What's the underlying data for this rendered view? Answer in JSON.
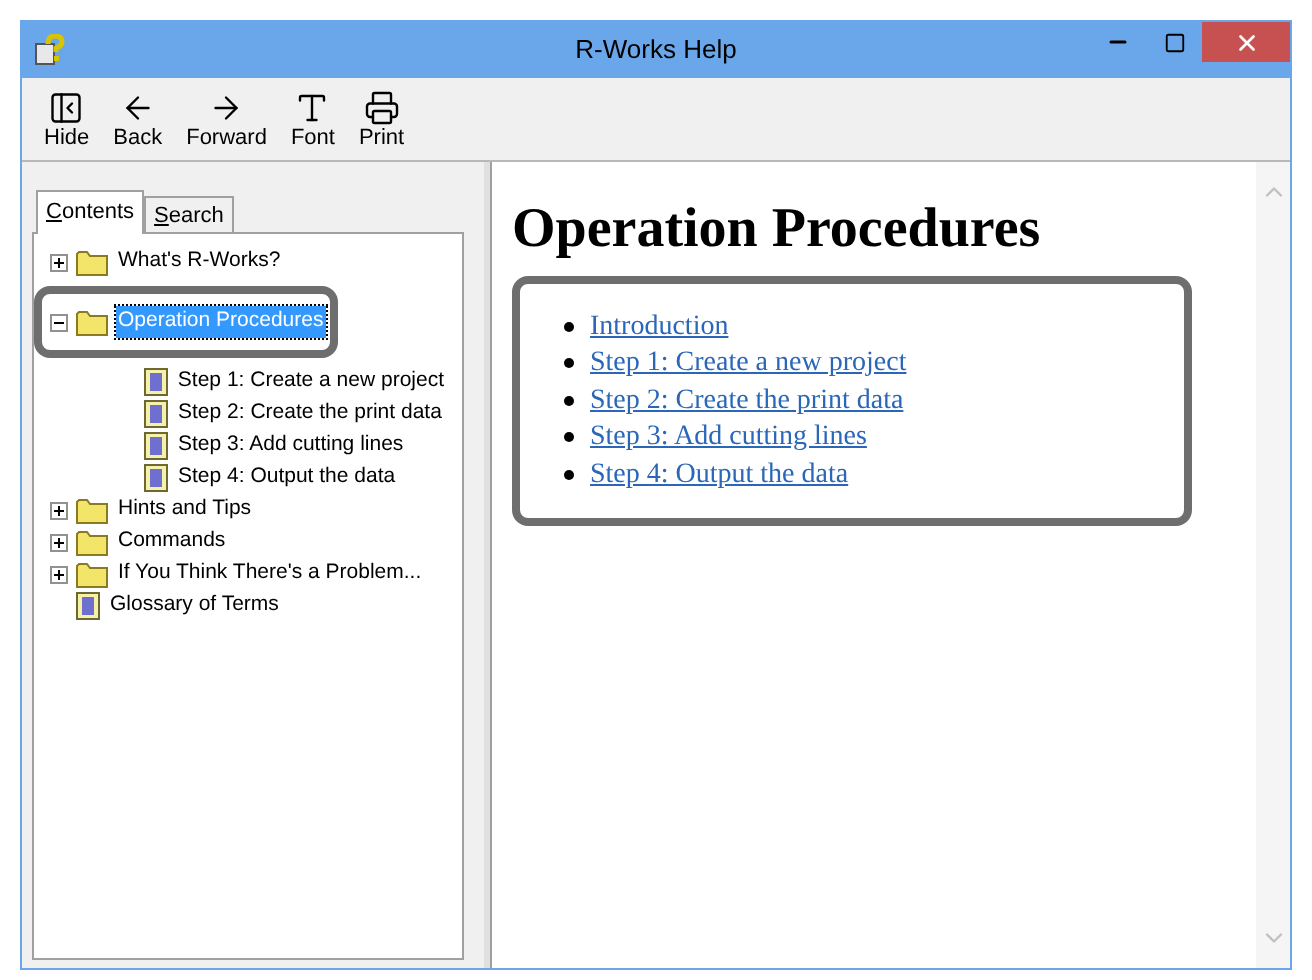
{
  "window": {
    "title": "R-Works Help"
  },
  "toolbar": {
    "buttons": [
      {
        "label": "Hide"
      },
      {
        "label": "Back"
      },
      {
        "label": "Forward"
      },
      {
        "label": "Font"
      },
      {
        "label": "Print"
      }
    ]
  },
  "tabs": [
    {
      "label": "Contents",
      "selected": true
    },
    {
      "label": "Search",
      "selected": false
    }
  ],
  "tree": {
    "items": [
      {
        "label": "What's R-Works?",
        "kind": "folder",
        "expanded": false,
        "selected": false
      },
      {
        "label": "Operation Procedures",
        "kind": "folder",
        "expanded": true,
        "selected": true,
        "highlighted": true,
        "children": [
          {
            "label": "Step 1: Create a new project",
            "kind": "page",
            "selected": false
          },
          {
            "label": "Step 2: Create the print data",
            "kind": "page",
            "selected": false
          },
          {
            "label": "Step 3: Add cutting lines",
            "kind": "page",
            "selected": false
          },
          {
            "label": "Step 4: Output the data",
            "kind": "page",
            "selected": false
          }
        ]
      },
      {
        "label": "Hints and Tips",
        "kind": "folder",
        "expanded": false,
        "selected": false
      },
      {
        "label": "Commands",
        "kind": "folder",
        "expanded": false,
        "selected": false
      },
      {
        "label": "If You Think There's a Problem...",
        "kind": "folder",
        "expanded": false,
        "selected": false
      },
      {
        "label": "Glossary of Terms",
        "kind": "page",
        "selected": false
      }
    ]
  },
  "content": {
    "heading": "Operation Procedures",
    "links_highlighted": true,
    "links": [
      "Introduction",
      "Step 1: Create a new project",
      "Step 2: Create the print data",
      "Step 3: Add cutting lines",
      "Step 4: Output the data"
    ]
  }
}
